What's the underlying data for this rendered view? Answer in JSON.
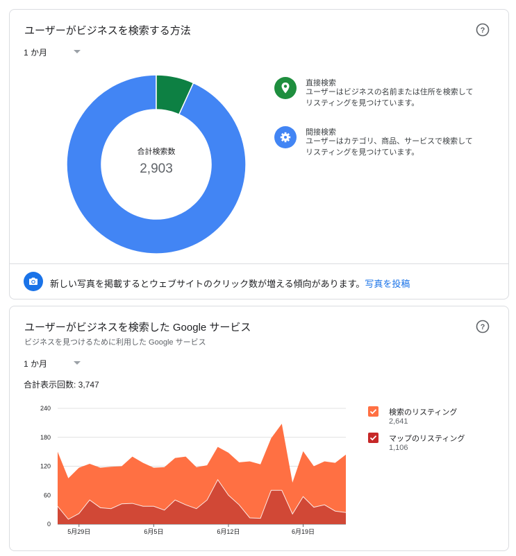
{
  "search_card": {
    "title": "ユーザーがビジネスを検索する方法",
    "period": "1 か月",
    "donut": {
      "center_label": "合計検索数",
      "center_value": "2,903",
      "direct_fraction": 0.068,
      "direct_color": "#0d8043",
      "indirect_color": "#4285f4"
    },
    "legend": [
      {
        "icon": "map-pin-icon",
        "title": "直接検索",
        "description": "ユーザーはビジネスの名前または住所を検索してリスティングを見つけています。",
        "color": "#1e8e3e"
      },
      {
        "icon": "gear-icon",
        "title": "間接検索",
        "description": "ユーザーはカテゴリ、商品、サービスで検索してリスティングを見つけています。",
        "color": "#4285f4"
      }
    ],
    "tip": {
      "text": "新しい写真を掲載するとウェブサイトのクリック数が増える傾向があります。",
      "link": "写真を投稿"
    }
  },
  "services_card": {
    "title": "ユーザーがビジネスを検索した Google サービス",
    "subtitle": "ビジネスを見つけるために利用した Google サービス",
    "period": "1 か月",
    "total_label": "合計表示回数: 3,747",
    "legend": [
      {
        "name": "検索のリスティング",
        "value": "2,641",
        "color": "#ff7043"
      },
      {
        "name": "マップのリスティング",
        "value": "1,106",
        "color": "#c62828"
      }
    ]
  },
  "chart_data": {
    "type": "area",
    "stacked": true,
    "x": [
      "5月25日",
      "5月26日",
      "5月27日",
      "5月28日",
      "5月29日",
      "5月30日",
      "5月31日",
      "6月1日",
      "6月2日",
      "6月3日",
      "6月4日",
      "6月5日",
      "6月6日",
      "6月7日",
      "6月8日",
      "6月9日",
      "6月10日",
      "6月11日",
      "6月12日",
      "6月13日",
      "6月14日",
      "6月15日",
      "6月16日",
      "6月17日",
      "6月18日",
      "6月19日",
      "6月20日",
      "6月21日",
      "6月22日",
      "6月23日",
      "6月24日"
    ],
    "x_tick_labels": [
      "5月29日",
      "6月5日",
      "6月12日",
      "6月19日"
    ],
    "x_tick_indices": [
      2,
      9,
      16,
      23
    ],
    "series": [
      {
        "name": "マップのリスティング",
        "color": "#d14836",
        "values": [
          37,
          10,
          22,
          50,
          34,
          32,
          42,
          43,
          37,
          37,
          29,
          50,
          40,
          32,
          50,
          92,
          60,
          40,
          13,
          12,
          70,
          70,
          21,
          57,
          35,
          40,
          27,
          24
        ]
      },
      {
        "name": "検索のリスティング",
        "color": "#ff7043",
        "values": [
          113,
          85,
          95,
          75,
          83,
          87,
          78,
          97,
          90,
          80,
          89,
          87,
          100,
          86,
          72,
          68,
          88,
          88,
          117,
          112,
          108,
          138,
          65,
          94,
          85,
          90,
          100,
          120
        ]
      }
    ],
    "totals": [
      150,
      95,
      117,
      125,
      117,
      119,
      120,
      140,
      127,
      117,
      118,
      137,
      140,
      118,
      122,
      160,
      148,
      128,
      130,
      124,
      178,
      208,
      86,
      151,
      120,
      130,
      127,
      144
    ],
    "ylim": [
      0,
      240
    ],
    "yticks": [
      0,
      60,
      120,
      180,
      240
    ],
    "grid": true
  }
}
